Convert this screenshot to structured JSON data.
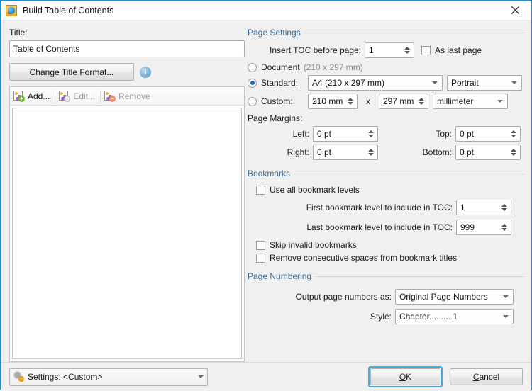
{
  "window": {
    "title": "Build Table of Contents",
    "icon": "toc-document-icon",
    "close_label": "✕"
  },
  "left": {
    "title_label": "Title:",
    "title_value": "Table of Contents",
    "title_placeholder": "Table of Contents",
    "change_format_button": "Change Title Format...",
    "info_glyph": "i",
    "toolbar": [
      {
        "label": "Add...",
        "enabled": true,
        "icon": "document-add-icon"
      },
      {
        "label": "Edit...",
        "enabled": false,
        "icon": "document-edit-icon"
      },
      {
        "label": "Remove",
        "enabled": false,
        "icon": "document-remove-icon"
      }
    ],
    "list_items": []
  },
  "page_settings": {
    "header": "Page Settings",
    "insert_toc_label": "Insert TOC before page:",
    "insert_toc_value": "1",
    "as_last_page_label": "As last page",
    "as_last_page_checked": false,
    "source_selected": "standard",
    "document_label": "Document",
    "document_dims": "(210 x 297 mm)",
    "standard_label": "Standard:",
    "standard_value": "A4 (210 x 297 mm)",
    "orientation_value": "Portrait",
    "custom_label": "Custom:",
    "custom_width": "210 mm",
    "custom_x": "x",
    "custom_height": "297 mm",
    "custom_unit": "millimeter"
  },
  "page_margins": {
    "header": "Page Margins:",
    "left_label": "Left:",
    "left_value": "0 pt",
    "right_label": "Right:",
    "right_value": "0 pt",
    "top_label": "Top:",
    "top_value": "0 pt",
    "bottom_label": "Bottom:",
    "bottom_value": "0 pt"
  },
  "bookmarks": {
    "header": "Bookmarks",
    "use_all_label": "Use all bookmark levels",
    "use_all_checked": false,
    "first_level_label": "First bookmark level to include in TOC:",
    "first_level_value": "1",
    "last_level_label": "Last bookmark level to include in TOC:",
    "last_level_value": "999",
    "skip_invalid_label": "Skip invalid bookmarks",
    "skip_invalid_checked": false,
    "remove_spaces_label": "Remove consecutive spaces from bookmark titles",
    "remove_spaces_checked": false
  },
  "page_numbering": {
    "header": "Page Numbering",
    "output_label": "Output page numbers as:",
    "output_value": "Original Page Numbers",
    "style_label": "Style:",
    "style_value": "Chapter..........1"
  },
  "footer": {
    "settings_label": "Settings: <Custom>",
    "settings_icon": "gear-icon",
    "ok_prefix": "O",
    "ok_rest": "K",
    "cancel_prefix": "C",
    "cancel_rest": "ancel"
  },
  "colors": {
    "group_header": "#3c6a92",
    "accent": "#1b8ad0",
    "focus_ring": "#4aa8e0",
    "radio_dot": "#1b6fc4"
  }
}
